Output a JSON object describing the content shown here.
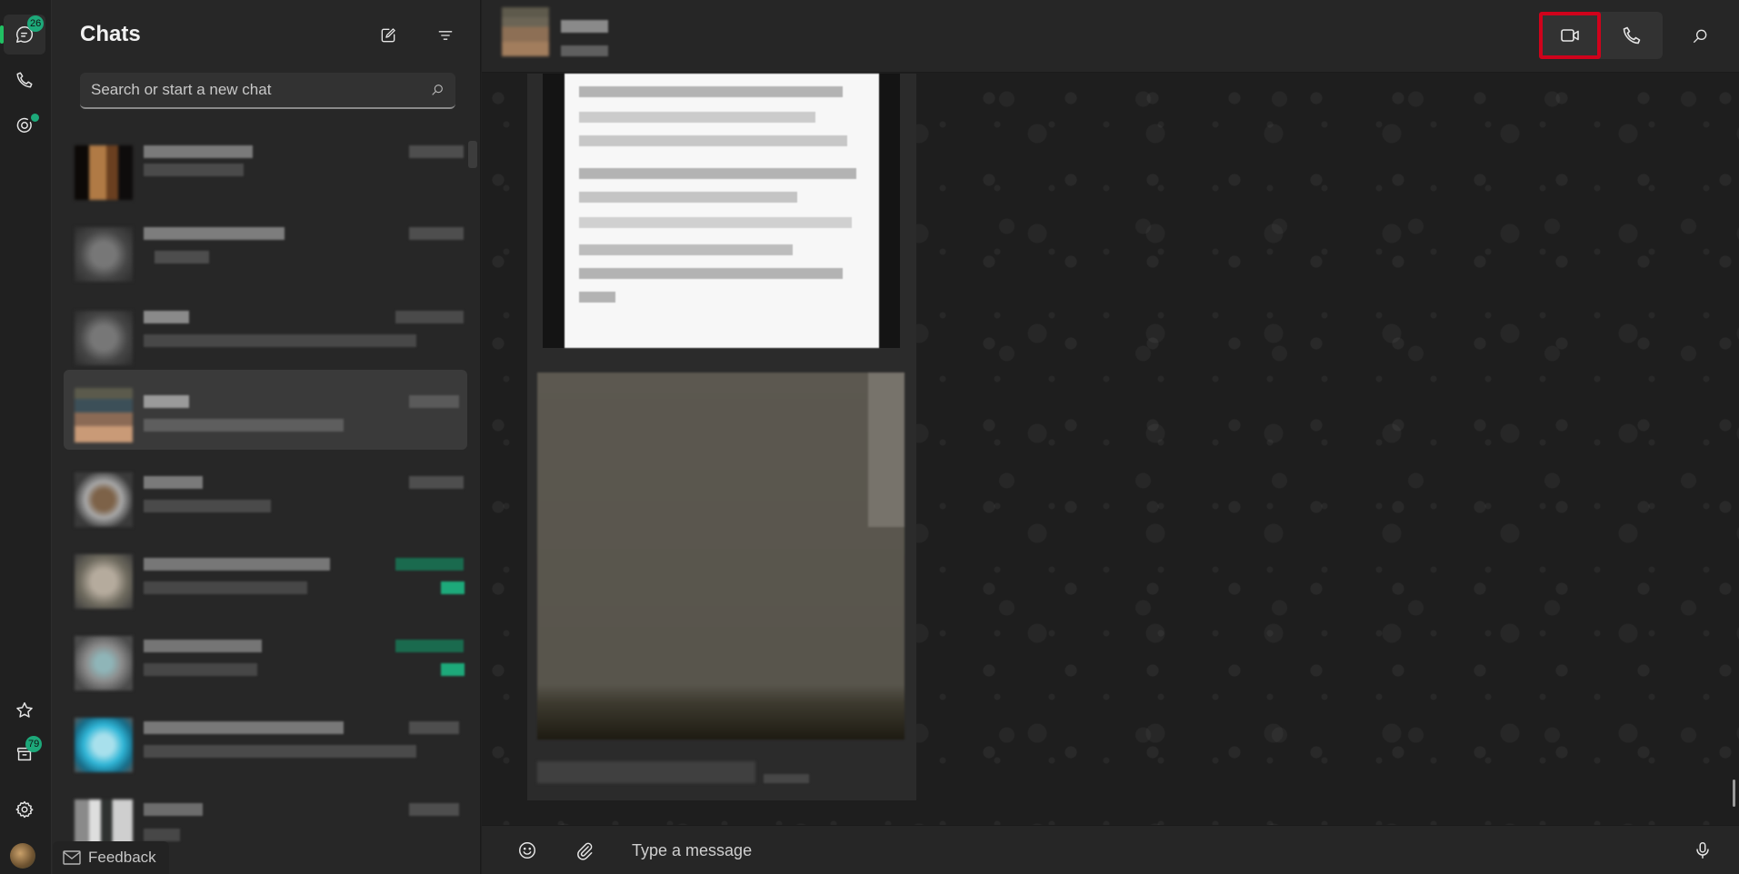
{
  "nav": {
    "chats": {
      "label": "Chats",
      "badge": "26"
    },
    "calls": {
      "label": "Calls"
    },
    "status": {
      "label": "Status",
      "has_update_dot": true
    },
    "starred": {
      "label": "Starred messages"
    },
    "archived": {
      "label": "Archived",
      "badge": "79"
    },
    "settings": {
      "label": "Settings"
    },
    "profile": {
      "label": "Profile"
    }
  },
  "chat_list": {
    "title": "Chats",
    "new_chat_label": "New chat",
    "filter_label": "Filter",
    "search": {
      "placeholder": "Search or start a new chat",
      "value": ""
    },
    "items": [
      {
        "redacted": true,
        "selected": false,
        "unread": false
      },
      {
        "redacted": true,
        "selected": false,
        "unread": false
      },
      {
        "redacted": true,
        "selected": false,
        "unread": false
      },
      {
        "redacted": true,
        "selected": true,
        "unread": false
      },
      {
        "redacted": true,
        "selected": false,
        "unread": false
      },
      {
        "redacted": true,
        "selected": false,
        "unread": true
      },
      {
        "redacted": true,
        "selected": false,
        "unread": true
      },
      {
        "redacted": true,
        "selected": false,
        "unread": false
      },
      {
        "redacted": true,
        "selected": false,
        "unread": false
      }
    ]
  },
  "feedback": {
    "label": "Feedback"
  },
  "conversation": {
    "header": {
      "contact_redacted": true
    },
    "actions": {
      "video_call": {
        "label": "Video call",
        "highlighted": true
      },
      "voice_call": {
        "label": "Voice call"
      },
      "search": {
        "label": "Search"
      }
    },
    "messages": [
      {
        "type": "image",
        "content": "document-photo",
        "redacted": true
      },
      {
        "type": "image",
        "content": "photo",
        "redacted": true,
        "caption_redacted": true
      }
    ],
    "composer": {
      "placeholder": "Type a message",
      "value": "",
      "emoji_label": "Emoji",
      "attach_label": "Attach",
      "mic_label": "Voice message"
    }
  },
  "colors": {
    "accent": "#1da97a",
    "highlight_outline": "#d0021b",
    "background": "#1e1e1e",
    "panel": "#272727"
  }
}
